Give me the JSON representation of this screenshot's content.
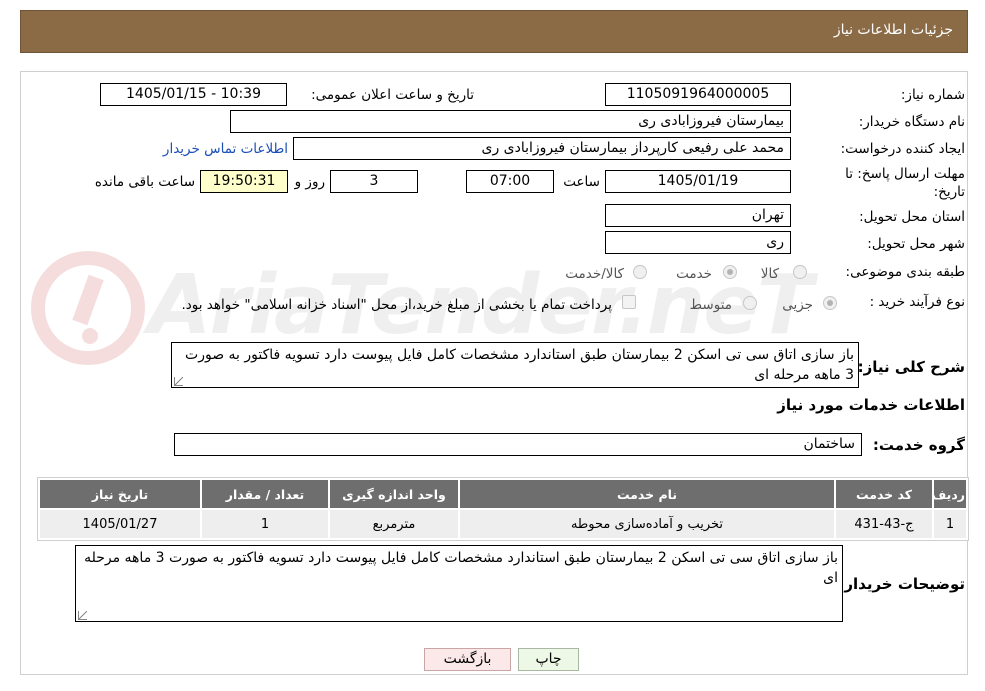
{
  "header": {
    "title": "جزئیات اطلاعات نیاز"
  },
  "watermark": {
    "text": "AriaTender.neT"
  },
  "form": {
    "need_number_label": "شماره نیاز:",
    "need_number": "1105091964000005",
    "announce_label": "تاریخ و ساعت اعلان عمومی:",
    "announce_value": "1405/01/15 - 10:39",
    "buyer_org_label": "نام دستگاه خریدار:",
    "buyer_org": "بیمارستان فیروزابادی ری",
    "requester_label": "ایجاد کننده درخواست:",
    "requester": "محمد علی رفیعی کارپرداز بیمارستان فیروزابادی ری",
    "contact_link": "اطلاعات تماس خریدار",
    "deadline_label_line1": "مهلت ارسال پاسخ: تا",
    "deadline_label_line2": "تاریخ:",
    "deadline_date": "1405/01/19",
    "time_label": "ساعت",
    "deadline_time": "07:00",
    "days_value": "3",
    "days_label": "روز و",
    "remaining_time": "19:50:31",
    "remaining_label": "ساعت باقی مانده",
    "province_label": "استان محل تحویل:",
    "province": "تهران",
    "city_label": "شهر محل تحویل:",
    "city": "ری",
    "category_label": "طبقه بندی موضوعی:",
    "category_options": [
      "کالا",
      "خدمت",
      "کالا/خدمت"
    ],
    "category_selected": "خدمت",
    "process_label": "نوع فرآیند خرید :",
    "process_options": [
      "جزیی",
      "متوسط"
    ],
    "process_selected": "جزیی",
    "payment_note": "پرداخت تمام یا بخشی از مبلغ خرید،از محل \"اسناد خزانه اسلامی\" خواهد بود.",
    "summary_label": "شرح کلی نیاز:",
    "summary": "باز سازی اتاق سی تی اسکن 2 بیمارستان طبق استاندارد مشخصات کامل فایل پیوست دارد تسویه فاکتور به صورت 3 ماهه مرحله ای",
    "services_section_title": "اطلاعات خدمات مورد نیاز",
    "service_group_label": "گروه خدمت:",
    "service_group": "ساختمان",
    "buyer_notes_label": "توضیحات خریدار:",
    "buyer_notes": "باز سازی اتاق سی تی اسکن 2 بیمارستان طبق استاندارد مشخصات کامل فایل پیوست دارد تسویه فاکتور به صورت 3 ماهه مرحله ای"
  },
  "table": {
    "headers": [
      "ردیف",
      "کد خدمت",
      "نام خدمت",
      "واحد اندازه گیری",
      "تعداد / مقدار",
      "تاریخ نیاز"
    ],
    "rows": [
      [
        "1",
        "ج-43-431",
        "تخریب و آماده‌سازی محوطه",
        "مترمربع",
        "1",
        "1405/01/27"
      ]
    ]
  },
  "buttons": {
    "print": "چاپ",
    "back": "بازگشت"
  },
  "colors": {
    "header_bg": "#8b6b46",
    "table_header_bg": "#6e6e6e",
    "link": "#1a4fb8",
    "remaining_bg": "#ffffcc"
  }
}
